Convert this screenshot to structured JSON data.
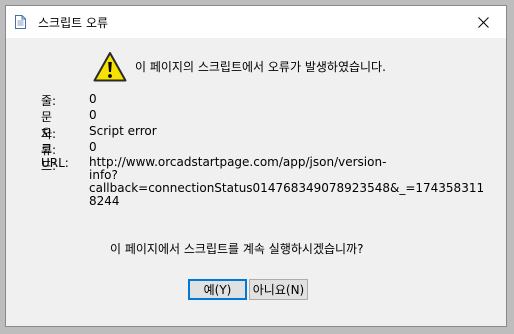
{
  "window": {
    "title": "스크립트 오류"
  },
  "message": {
    "headline": "이 페이지의 스크립트에서 오류가 발생하였습니다.",
    "question": "이 페이지에서 스크립트를 계속 실행하시겠습니까?"
  },
  "details": {
    "line_label": "줄:",
    "line_value": "0",
    "char_label": "문자:",
    "char_value": "0",
    "error_label": "오류:",
    "error_value": "Script error",
    "code_label": "코드:",
    "code_value": "0",
    "url_label": "URL:",
    "url_line1": "http://www.orcadstartpage.com/app/json/version-info?",
    "url_line2": "callback=connectionStatus014768349078923548&_=174358311",
    "url_line3": "8244"
  },
  "buttons": {
    "yes_label": "예(Y)",
    "no_label": "아니요(N)"
  },
  "icons": {
    "title_icon": "document-icon",
    "warning_icon": "warning-icon",
    "close_icon": "close-icon"
  }
}
